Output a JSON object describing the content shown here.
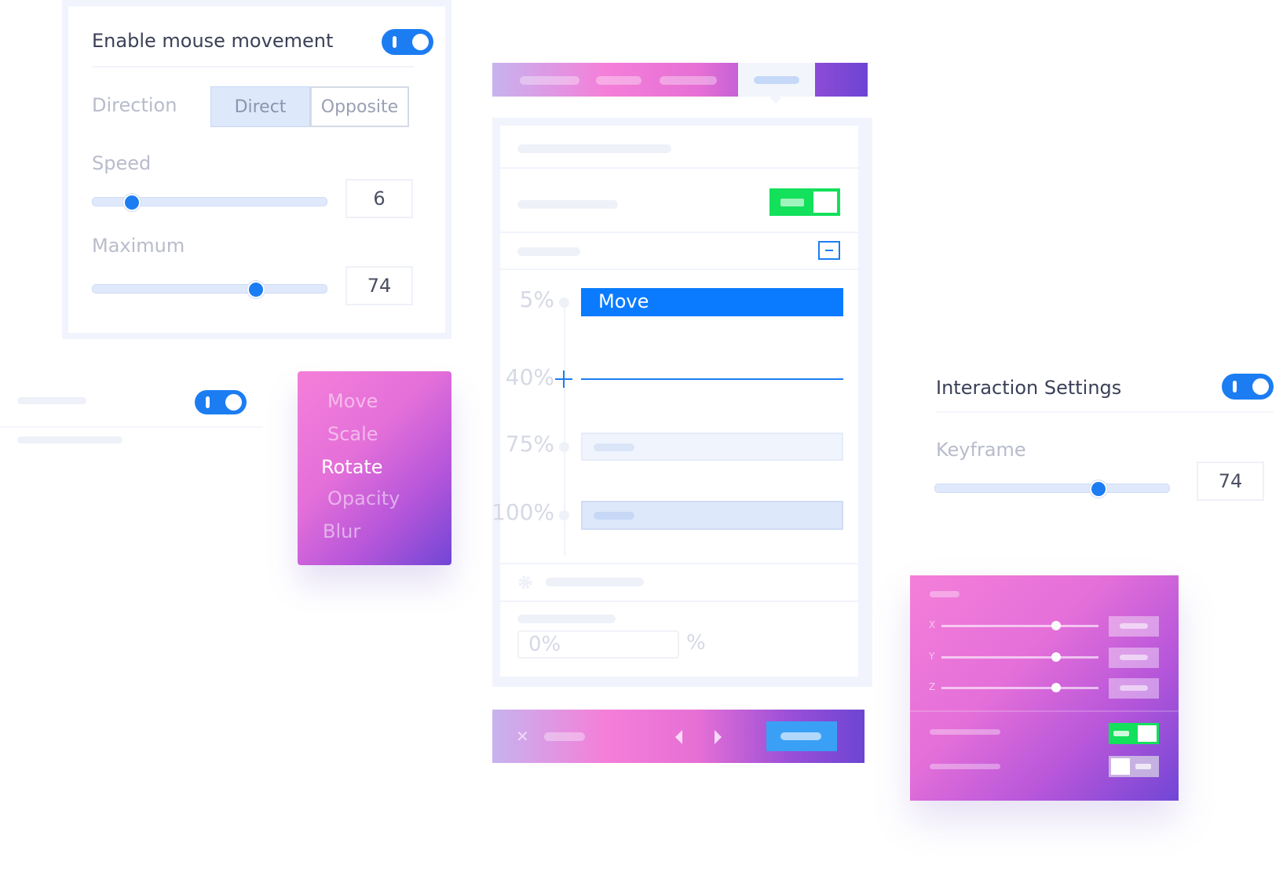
{
  "mouse_panel": {
    "title": "Enable mouse movement",
    "toggle_on": true,
    "direction_label": "Direction",
    "direction_options": [
      "Direct",
      "Opposite"
    ],
    "direction_selected": "Direct",
    "speed_label": "Speed",
    "speed_value": "6",
    "speed_fraction": 0.17,
    "maximum_label": "Maximum",
    "maximum_value": "74",
    "maximum_fraction": 0.7
  },
  "side_toggle": {
    "toggle_on": true
  },
  "effect_menu": {
    "items": [
      "Move",
      "Scale",
      "Rotate",
      "Opacity",
      "Blur"
    ],
    "selected": "Rotate"
  },
  "keyframes_panel": {
    "keyframes": [
      {
        "percent": "5%",
        "label": "Move"
      },
      {
        "percent": "40%",
        "label": ""
      },
      {
        "percent": "75%",
        "label": ""
      },
      {
        "percent": "100%",
        "label": ""
      }
    ],
    "value_input": "0%",
    "unit": "%"
  },
  "interaction_panel": {
    "title": "Interaction Settings",
    "toggle_on": true,
    "keyframe_label": "Keyframe",
    "keyframe_value": "74",
    "keyframe_fraction": 0.7
  },
  "xyz_panel": {
    "axes": [
      "X",
      "Y",
      "Z"
    ],
    "axis_fractions": [
      0.73,
      0.73,
      0.73
    ],
    "toggle1_on": true,
    "toggle2_on": false
  },
  "colors": {
    "accent": "#1c7df2",
    "selected_bar": "#0a7bff",
    "green": "#13e05b",
    "gradient_pink": "#f47fd9",
    "gradient_purple": "#6d45d3"
  },
  "icons": {
    "close": "close-icon",
    "prev": "chevron-left-icon",
    "next": "chevron-right-icon",
    "collapse": "minus-square-icon",
    "settings": "gear-icon"
  }
}
